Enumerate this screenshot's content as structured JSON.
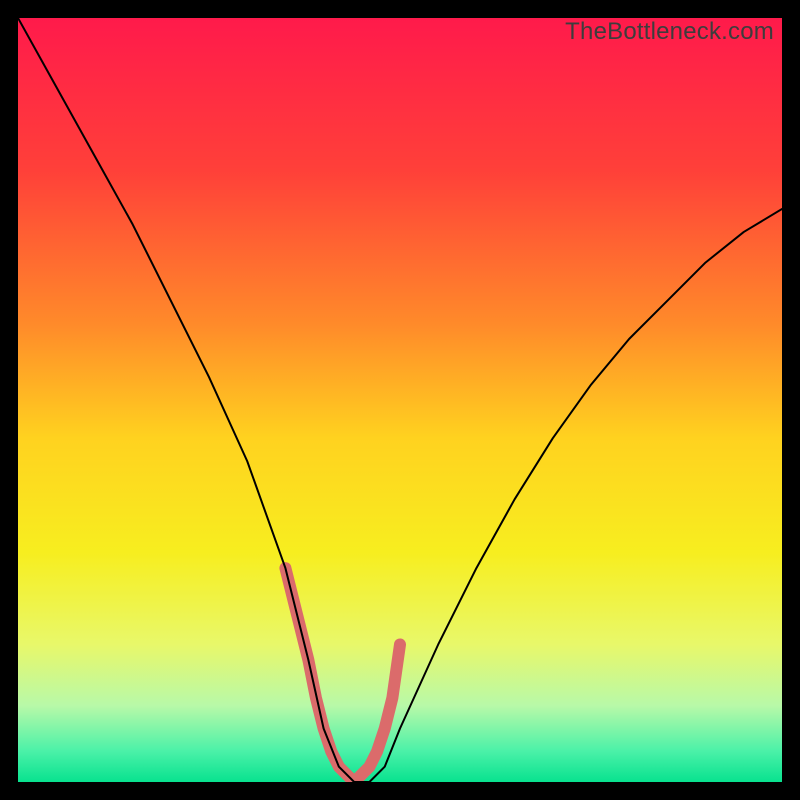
{
  "watermark": "TheBottleneck.com",
  "chart_data": {
    "type": "line",
    "title": "",
    "xlabel": "",
    "ylabel": "",
    "xlim": [
      0,
      100
    ],
    "ylim": [
      0,
      100
    ],
    "background_gradient": {
      "stops": [
        {
          "pos": 0.0,
          "color": "#ff1a4b"
        },
        {
          "pos": 0.2,
          "color": "#ff4039"
        },
        {
          "pos": 0.4,
          "color": "#ff8a2a"
        },
        {
          "pos": 0.55,
          "color": "#ffd21f"
        },
        {
          "pos": 0.7,
          "color": "#f7ee1f"
        },
        {
          "pos": 0.82,
          "color": "#e8f86a"
        },
        {
          "pos": 0.9,
          "color": "#b8f9a8"
        },
        {
          "pos": 0.96,
          "color": "#4af1a8"
        },
        {
          "pos": 1.0,
          "color": "#08e28f"
        }
      ]
    },
    "series": [
      {
        "name": "bottleneck-curve",
        "color": "#000000",
        "width": 2.0,
        "x": [
          0,
          5,
          10,
          15,
          20,
          25,
          30,
          35,
          38,
          40,
          42,
          44,
          46,
          48,
          50,
          55,
          60,
          65,
          70,
          75,
          80,
          85,
          90,
          95,
          100
        ],
        "y": [
          100,
          91,
          82,
          73,
          63,
          53,
          42,
          28,
          16,
          7,
          2,
          0,
          0,
          2,
          7,
          18,
          28,
          37,
          45,
          52,
          58,
          63,
          68,
          72,
          75
        ]
      },
      {
        "name": "highlight-band",
        "color": "#db6b6b",
        "width": 12,
        "linecap": "round",
        "x": [
          35,
          36,
          37,
          38,
          39,
          40,
          41,
          42,
          43,
          44,
          45,
          46,
          47,
          48,
          49,
          50
        ],
        "y": [
          28,
          24,
          20,
          16,
          11,
          7,
          4,
          2,
          1,
          0,
          1,
          2,
          4,
          7,
          11,
          18
        ]
      }
    ]
  }
}
